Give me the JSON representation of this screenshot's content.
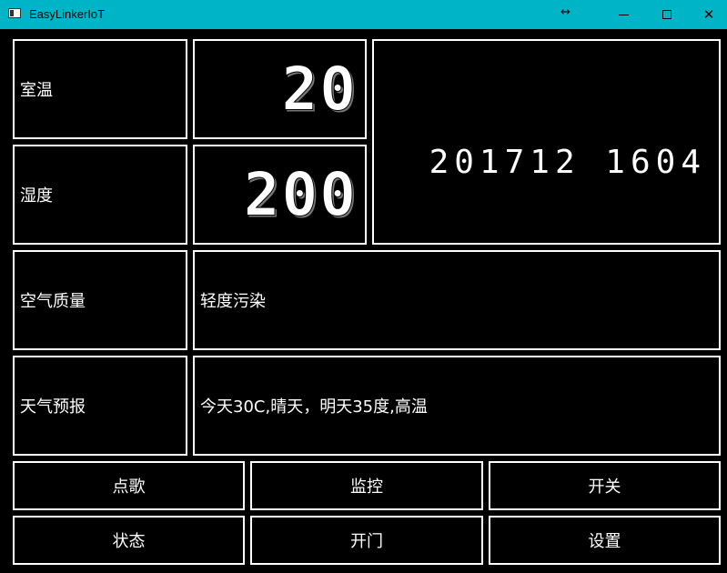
{
  "window": {
    "title": "EasyLinkerIoT",
    "resize_glyph": "↔",
    "close_glyph": "✕"
  },
  "temperature": {
    "label": "室温",
    "value": "20"
  },
  "humidity": {
    "label": "湿度",
    "value": "200"
  },
  "clock": {
    "value": "201712 1604"
  },
  "air_quality": {
    "label": "空气质量",
    "value": "轻度污染"
  },
  "weather": {
    "label": "天气预报",
    "value": "今天30C,晴天，明天35度,高温"
  },
  "buttons": {
    "music": "点歌",
    "monitor": "监控",
    "switch": "开关",
    "status": "状态",
    "open_door": "开门",
    "settings": "设置"
  }
}
